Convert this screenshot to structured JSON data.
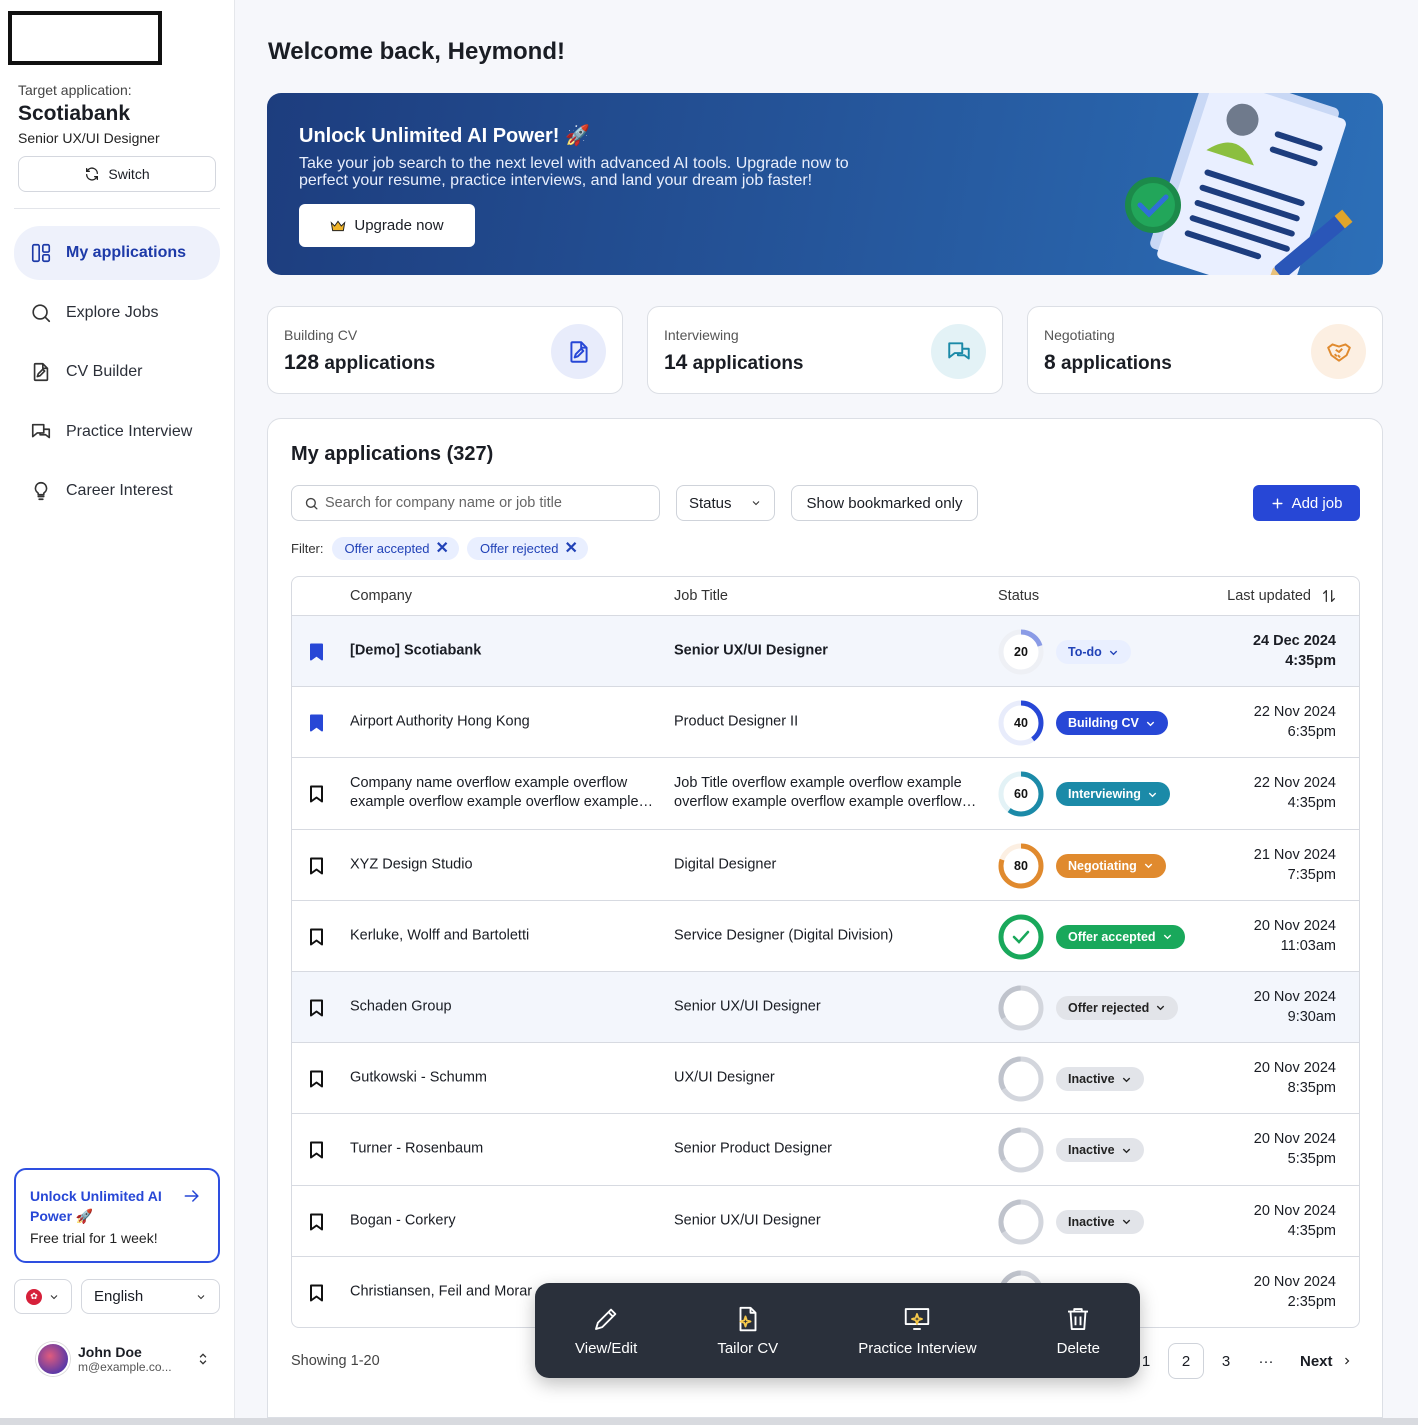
{
  "sidebar": {
    "target_label": "Target application:",
    "target_company": "Scotiabank",
    "target_role": "Senior UX/UI Designer",
    "switch_label": "Switch",
    "nav": [
      {
        "label": "My applications",
        "icon": "dashboard-icon",
        "active": true
      },
      {
        "label": "Explore Jobs",
        "icon": "search-icon"
      },
      {
        "label": "CV Builder",
        "icon": "document-edit-icon"
      },
      {
        "label": "Practice Interview",
        "icon": "chat-icon"
      },
      {
        "label": "Career Interest",
        "icon": "lightbulb-icon"
      }
    ],
    "promo_title": "Unlock Unlimited AI Power 🚀",
    "promo_sub": "Free trial for 1 week!",
    "language": "English",
    "user_name": "John Doe",
    "user_email": "m@example.co..."
  },
  "welcome": "Welcome back, Heymond!",
  "banner": {
    "title": "Unlock Unlimited AI Power! 🚀",
    "text": "Take your job search to the next level with advanced AI tools. Upgrade now to perfect your resume, practice interviews, and land your dream job faster!",
    "button": "Upgrade now"
  },
  "stats": [
    {
      "label": "Building CV",
      "count": "128",
      "unit": "applications",
      "icon": "document-edit-icon",
      "color": "#2747d6",
      "bg": "#e8ecfb"
    },
    {
      "label": "Interviewing",
      "count": "14",
      "unit": "applications",
      "icon": "chat-icon",
      "color": "#1b8aa8",
      "bg": "#e3f2f6"
    },
    {
      "label": "Negotiating",
      "count": "8",
      "unit": "applications",
      "icon": "handshake-icon",
      "color": "#e08a2e",
      "bg": "#fcefe2"
    }
  ],
  "panel": {
    "title": "My applications (327)",
    "search_placeholder": "Search for company name or job title",
    "status_label": "Status",
    "bookmark_label": "Show bookmarked only",
    "add_label": "Add job",
    "filter_label": "Filter:",
    "filters": [
      "Offer accepted",
      "Offer rejected"
    ],
    "columns": {
      "company": "Company",
      "title": "Job Title",
      "status": "Status",
      "updated": "Last updated"
    }
  },
  "rows": [
    {
      "company": "[Demo] Scotiabank",
      "title": "Senior UX/UI Designer",
      "progress": "20",
      "status": "To-do",
      "date": "24 Dec 2024",
      "time": "4:35pm",
      "bookmarked": true
    },
    {
      "company": "Airport Authority Hong Kong",
      "title": "Product Designer II",
      "progress": "40",
      "status": "Building CV",
      "date": "22 Nov 2024",
      "time": "6:35pm",
      "bookmarked": true
    },
    {
      "company": "Company name overflow example overflow example overflow example overflow example overflow",
      "title": "Job Title overflow example overflow example overflow example overflow example overflow example",
      "progress": "60",
      "status": "Interviewing",
      "date": "22 Nov 2024",
      "time": "4:35pm",
      "bookmarked": false
    },
    {
      "company": "XYZ Design Studio",
      "title": "Digital Designer",
      "progress": "80",
      "status": "Negotiating",
      "date": "21 Nov 2024",
      "time": "7:35pm",
      "bookmarked": false
    },
    {
      "company": "Kerluke, Wolff and Bartoletti",
      "title": "Service Designer (Digital Division)",
      "progress": "",
      "status": "Offer accepted",
      "date": "20 Nov 2024",
      "time": "11:03am",
      "bookmarked": false
    },
    {
      "company": "Schaden Group",
      "title": "Senior UX/UI Designer",
      "progress": "",
      "status": "Offer rejected",
      "date": "20 Nov 2024",
      "time": "9:30am",
      "bookmarked": false
    },
    {
      "company": "Gutkowski - Schumm",
      "title": "UX/UI Designer",
      "progress": "",
      "status": "Inactive",
      "date": "20 Nov 2024",
      "time": "8:35pm",
      "bookmarked": false
    },
    {
      "company": "Turner - Rosenbaum",
      "title": "Senior Product Designer",
      "progress": "",
      "status": "Inactive",
      "date": "20 Nov 2024",
      "time": "5:35pm",
      "bookmarked": false
    },
    {
      "company": "Bogan - Corkery",
      "title": "Senior UX/UI Designer",
      "progress": "",
      "status": "Inactive",
      "date": "20 Nov 2024",
      "time": "4:35pm",
      "bookmarked": false
    },
    {
      "company": "Christiansen, Feil and Morar",
      "title": "",
      "progress": "",
      "status": "",
      "date": "20 Nov 2024",
      "time": "2:35pm",
      "bookmarked": false
    }
  ],
  "showing": "Showing 1-20",
  "pager": {
    "pages": [
      "1",
      "2",
      "3",
      "···"
    ],
    "next": "Next"
  },
  "actions": [
    {
      "label": "View/Edit",
      "icon": "pencil-icon"
    },
    {
      "label": "Tailor CV",
      "icon": "sparkle-document-icon"
    },
    {
      "label": "Practice Interview",
      "icon": "sparkle-presentation-icon"
    },
    {
      "label": "Delete",
      "icon": "trash-icon"
    }
  ]
}
